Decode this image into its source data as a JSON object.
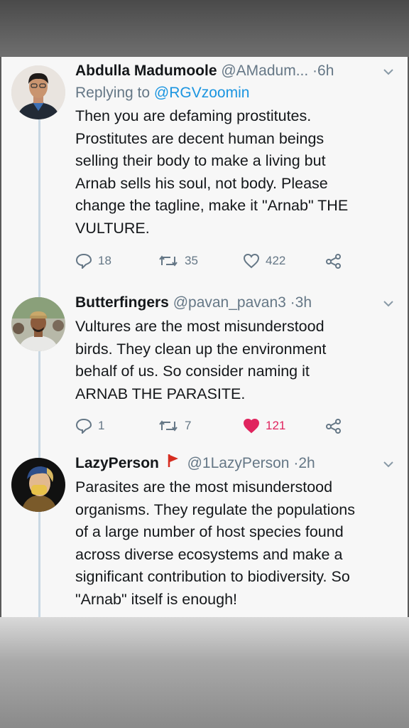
{
  "tweets": [
    {
      "name": "Abdulla Madumoole",
      "handle": "@AMadum...",
      "dot": "·",
      "time": "6h",
      "reply_prefix": "Replying to",
      "reply_to": "@RGVzoomin",
      "text": "Then you are defaming prostitutes.\nProstitutes are decent human beings\nselling their body to make a living but\nArnab sells his soul, not body. Please\nchange the tagline, make it \"Arnab\" THE\nVULTURE.",
      "replies": "18",
      "retweets": "35",
      "likes": "422",
      "liked": false
    },
    {
      "name": "Butterfingers",
      "handle": "@pavan_pavan3",
      "dot": "·",
      "time": "3h",
      "text": "Vultures are the most misunderstood\nbirds. They clean up the environment\nbehalf of us. So consider naming it\nARNAB THE PARASITE.",
      "replies": "1",
      "retweets": "7",
      "likes": "121",
      "liked": true
    },
    {
      "name": "LazyPerson",
      "handle": "@1LazyPerson",
      "dot": "·",
      "time": "2h",
      "text": "Parasites are the most misunderstood\norganisms. They regulate the populations\nof a large number of host species found\nacross diverse ecosystems and make a\nsignificant contribution to biodiversity. So\n\"Arnab\" itself is enough!"
    }
  ],
  "colors": {
    "like_active": "#e0245e",
    "link": "#1b95e0",
    "muted": "#657786",
    "thread_line": "#c9d8e3"
  }
}
